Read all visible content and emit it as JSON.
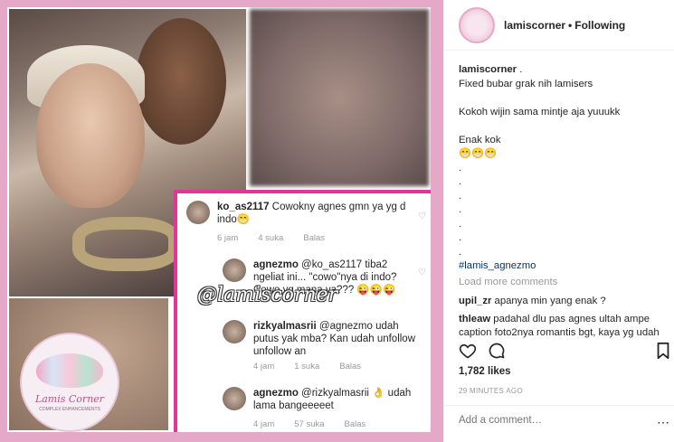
{
  "post": {
    "overlay": {
      "comments": [
        {
          "user": "ko_as2117",
          "text": "Cowokny agnes gmn ya yg d indo😁",
          "time": "6 jam",
          "likes": "4 suka",
          "reply": "Balas"
        },
        {
          "user": "agnezmo",
          "text": "@ko_as2117 tiba2 ngeliat ini... \"cowo\"nya di indo? Cowo yg mana ya??? 😜😜😜",
          "time": "",
          "likes": "",
          "reply": ""
        },
        {
          "user": "rizkyalmasrii",
          "text": "@agnezmo udah putus yak mba? Kan udah unfollow unfollow an",
          "time": "4 jam",
          "likes": "1 suka",
          "reply": "Balas"
        },
        {
          "user": "agnezmo",
          "text": "@rizkyalmasrii 👌 udah lama bangeeeeet",
          "time": "4 jam",
          "likes": "57 suka",
          "reply": "Balas"
        }
      ],
      "watermark": "@lamiscorner"
    },
    "logo": {
      "title": "Lamis Corner",
      "subtitle": "COMPLEX ENHANCEMENTS"
    }
  },
  "header": {
    "username": "lamiscorner",
    "separator": "•",
    "follow_status": "Following"
  },
  "caption": {
    "username": "lamiscorner",
    "after_username": ".",
    "lines": [
      "Fixed bubar grak nih lamisers",
      "",
      "Kokoh wijin sama mintje aja yuuukk",
      "",
      "Enak kok",
      "😁😁😁",
      ".",
      ".",
      ".",
      ".",
      ".",
      ".",
      "."
    ],
    "hashtag": "#lamis_agnezmo"
  },
  "load_more": "Load more comments",
  "comments": [
    {
      "user": "upil_zr",
      "text": "apanya min yang enak ?"
    },
    {
      "user": "thleaw",
      "text": "padahal dlu pas agnes ultah ampe caption foto2nya romantis bgt, kaya yg udah"
    }
  ],
  "likes": "1,782 likes",
  "time_ago": "29 MINUTES AGO",
  "add_comment": {
    "placeholder": "Add a comment…"
  },
  "icons": {
    "like": "heart-icon",
    "comment": "comment-icon",
    "save": "bookmark-icon",
    "more": "more-icon"
  }
}
